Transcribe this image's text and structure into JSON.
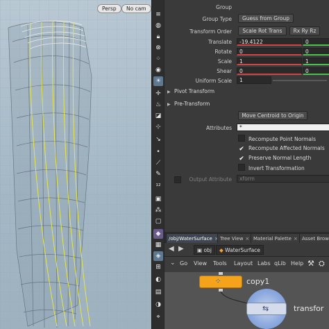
{
  "viewport": {
    "camera_mode": "Persp",
    "camera_name": "No cam"
  },
  "shelf_tools": [
    "shelf-handle-icon",
    "sphere-icon",
    "lock-icon",
    "close-circle-icon",
    "dots-icon",
    "circle-icon",
    "bulb-icon",
    "cursor-icon",
    "flame-icon",
    "mask-icon",
    "pivot-icon",
    "arrow-icon",
    "point-icon",
    "edge-icon",
    "brush-icon",
    "number-icon",
    "camera-icon",
    "spray-icon",
    "display-icon",
    "eye-icon",
    "wireframe-icon",
    "shaded-icon",
    "grid-icon",
    "lamp-icon",
    "image-icon",
    "palette-icon",
    "snap-icon"
  ],
  "params": {
    "group": {
      "label": "Group",
      "value": ""
    },
    "group_type": {
      "label": "Group Type",
      "value": "Guess from Group"
    },
    "transform_order": {
      "label": "Transform Order",
      "value": "Scale Rot Trans",
      "value2": "Rx Ry Rz"
    },
    "translate": {
      "label": "Translate",
      "x": "-19.4122",
      "y": "0"
    },
    "rotate": {
      "label": "Rotate",
      "x": "0",
      "y": "0"
    },
    "scale": {
      "label": "Scale",
      "x": "1",
      "y": "1"
    },
    "shear": {
      "label": "Shear",
      "x": "0",
      "y": "0"
    },
    "uniform_scale": {
      "label": "Uniform Scale",
      "value": "1"
    },
    "pivot_transform": "Pivot Transform",
    "pre_transform": "Pre-Transform",
    "move_centroid": "Move Centroid to Origin",
    "attributes": {
      "label": "Attributes",
      "value": "*"
    },
    "checks": [
      {
        "label": "Recompute Point Normals",
        "checked": false
      },
      {
        "label": "Recompute Affected Normals",
        "checked": true
      },
      {
        "label": "Preserve Normal Length",
        "checked": true
      },
      {
        "label": "Invert Transformation",
        "checked": false
      }
    ],
    "output_attribute": {
      "label": "Output Attribute",
      "value": "xform"
    }
  },
  "network": {
    "tabs": [
      {
        "label": "/obj/WaterSurface",
        "active": true
      },
      {
        "label": "Tree View",
        "active": false
      },
      {
        "label": "Material Palette",
        "active": false
      },
      {
        "label": "Asset Brow",
        "active": false
      }
    ],
    "path": {
      "root": "obj",
      "node": "WaterSurface"
    },
    "menu": [
      "Go",
      "View",
      "Tools",
      "Layout",
      "Labs",
      "qLib",
      "Help"
    ],
    "nodes": [
      {
        "name": "copy1"
      },
      {
        "name": "transfor"
      }
    ],
    "colors": {
      "copy_node": "#f5a31a",
      "transform_ring": "#6f92d6",
      "transform_body": "#d4dceb"
    }
  }
}
